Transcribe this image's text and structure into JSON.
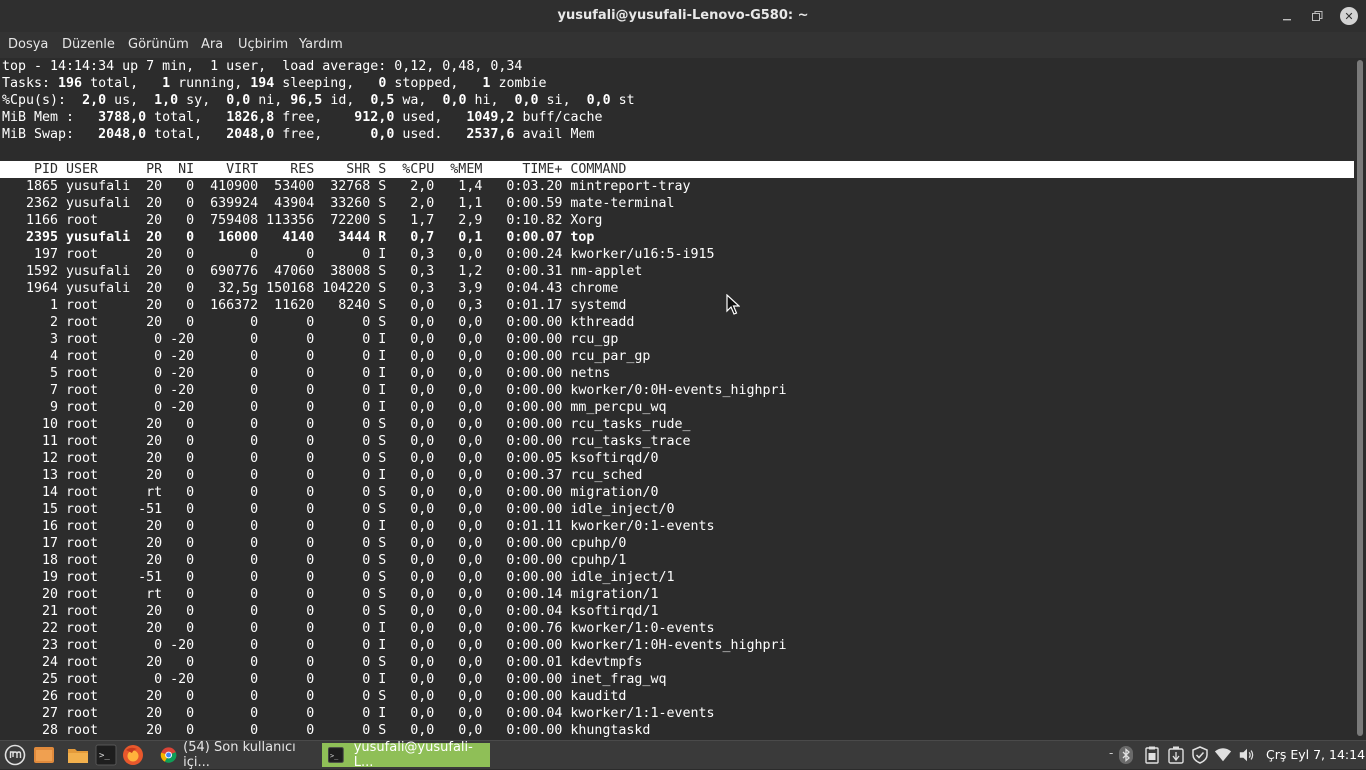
{
  "window": {
    "title": "yusufali@yusufali-Lenovo-G580: ~"
  },
  "menu": [
    "Dosya",
    "Düzenle",
    "Görünüm",
    "Ara",
    "Uçbirim",
    "Yardım"
  ],
  "top_summary": {
    "line1": "top - 14:14:34 up 7 min,  1 user,  load average: 0,12, 0,48, 0,34",
    "tasks": {
      "p1": "Tasks: ",
      "total": "196",
      "p2": " total,   ",
      "running": "1",
      "p3": " running, ",
      "sleeping": "194",
      "p4": " sleeping,   ",
      "stopped": "0",
      "p5": " stopped,   ",
      "zombie": "1",
      "p6": " zombie"
    },
    "cpu": {
      "p1": "%Cpu(s):  ",
      "us": "2,0",
      "p2": " us,  ",
      "sy": "1,0",
      "p3": " sy,  ",
      "ni": "0,0",
      "p4": " ni, ",
      "id": "96,5",
      "p5": " id,  ",
      "wa": "0,5",
      "p6": " wa,  ",
      "hi": "0,0",
      "p7": " hi,  ",
      "si": "0,0",
      "p8": " si,  ",
      "st": "0,0",
      "p9": " st"
    },
    "mem": {
      "p1": "MiB Mem :   ",
      "total": "3788,0",
      "p2": " total,   ",
      "free": "1826,8",
      "p3": " free,    ",
      "used": "912,0",
      "p4": " used,   ",
      "buff": "1049,2",
      "p5": " buff/cache"
    },
    "swap": {
      "p1": "MiB Swap:   ",
      "total": "2048,0",
      "p2": " total,   ",
      "free": "2048,0",
      "p3": " free,      ",
      "used": "0,0",
      "p4": " used.   ",
      "avail": "2537,6",
      "p5": " avail Mem"
    }
  },
  "columns": [
    "PID",
    "USER",
    "PR",
    "NI",
    "VIRT",
    "RES",
    "SHR",
    "S",
    "%CPU",
    "%MEM",
    "TIME+",
    "COMMAND"
  ],
  "processes": [
    [
      "1865",
      "yusufali",
      "20",
      "0",
      "410900",
      "53400",
      "32768",
      "S",
      "2,0",
      "1,4",
      "0:03.20",
      "mintreport-tray"
    ],
    [
      "2362",
      "yusufali",
      "20",
      "0",
      "639924",
      "43904",
      "33260",
      "S",
      "2,0",
      "1,1",
      "0:00.59",
      "mate-terminal"
    ],
    [
      "1166",
      "root",
      "20",
      "0",
      "759408",
      "113356",
      "72200",
      "S",
      "1,7",
      "2,9",
      "0:10.82",
      "Xorg"
    ],
    [
      "2395",
      "yusufali",
      "20",
      "0",
      "16000",
      "4140",
      "3444",
      "R",
      "0,7",
      "0,1",
      "0:00.07",
      "top"
    ],
    [
      "197",
      "root",
      "20",
      "0",
      "0",
      "0",
      "0",
      "I",
      "0,3",
      "0,0",
      "0:00.24",
      "kworker/u16:5-i915"
    ],
    [
      "1592",
      "yusufali",
      "20",
      "0",
      "690776",
      "47060",
      "38008",
      "S",
      "0,3",
      "1,2",
      "0:00.31",
      "nm-applet"
    ],
    [
      "1964",
      "yusufali",
      "20",
      "0",
      "32,5g",
      "150168",
      "104220",
      "S",
      "0,3",
      "3,9",
      "0:04.43",
      "chrome"
    ],
    [
      "1",
      "root",
      "20",
      "0",
      "166372",
      "11620",
      "8240",
      "S",
      "0,0",
      "0,3",
      "0:01.17",
      "systemd"
    ],
    [
      "2",
      "root",
      "20",
      "0",
      "0",
      "0",
      "0",
      "S",
      "0,0",
      "0,0",
      "0:00.00",
      "kthreadd"
    ],
    [
      "3",
      "root",
      "0",
      "-20",
      "0",
      "0",
      "0",
      "I",
      "0,0",
      "0,0",
      "0:00.00",
      "rcu_gp"
    ],
    [
      "4",
      "root",
      "0",
      "-20",
      "0",
      "0",
      "0",
      "I",
      "0,0",
      "0,0",
      "0:00.00",
      "rcu_par_gp"
    ],
    [
      "5",
      "root",
      "0",
      "-20",
      "0",
      "0",
      "0",
      "I",
      "0,0",
      "0,0",
      "0:00.00",
      "netns"
    ],
    [
      "7",
      "root",
      "0",
      "-20",
      "0",
      "0",
      "0",
      "I",
      "0,0",
      "0,0",
      "0:00.00",
      "kworker/0:0H-events_highpri"
    ],
    [
      "9",
      "root",
      "0",
      "-20",
      "0",
      "0",
      "0",
      "I",
      "0,0",
      "0,0",
      "0:00.00",
      "mm_percpu_wq"
    ],
    [
      "10",
      "root",
      "20",
      "0",
      "0",
      "0",
      "0",
      "S",
      "0,0",
      "0,0",
      "0:00.00",
      "rcu_tasks_rude_"
    ],
    [
      "11",
      "root",
      "20",
      "0",
      "0",
      "0",
      "0",
      "S",
      "0,0",
      "0,0",
      "0:00.00",
      "rcu_tasks_trace"
    ],
    [
      "12",
      "root",
      "20",
      "0",
      "0",
      "0",
      "0",
      "S",
      "0,0",
      "0,0",
      "0:00.05",
      "ksoftirqd/0"
    ],
    [
      "13",
      "root",
      "20",
      "0",
      "0",
      "0",
      "0",
      "I",
      "0,0",
      "0,0",
      "0:00.37",
      "rcu_sched"
    ],
    [
      "14",
      "root",
      "rt",
      "0",
      "0",
      "0",
      "0",
      "S",
      "0,0",
      "0,0",
      "0:00.00",
      "migration/0"
    ],
    [
      "15",
      "root",
      "-51",
      "0",
      "0",
      "0",
      "0",
      "S",
      "0,0",
      "0,0",
      "0:00.00",
      "idle_inject/0"
    ],
    [
      "16",
      "root",
      "20",
      "0",
      "0",
      "0",
      "0",
      "I",
      "0,0",
      "0,0",
      "0:01.11",
      "kworker/0:1-events"
    ],
    [
      "17",
      "root",
      "20",
      "0",
      "0",
      "0",
      "0",
      "S",
      "0,0",
      "0,0",
      "0:00.00",
      "cpuhp/0"
    ],
    [
      "18",
      "root",
      "20",
      "0",
      "0",
      "0",
      "0",
      "S",
      "0,0",
      "0,0",
      "0:00.00",
      "cpuhp/1"
    ],
    [
      "19",
      "root",
      "-51",
      "0",
      "0",
      "0",
      "0",
      "S",
      "0,0",
      "0,0",
      "0:00.00",
      "idle_inject/1"
    ],
    [
      "20",
      "root",
      "rt",
      "0",
      "0",
      "0",
      "0",
      "S",
      "0,0",
      "0,0",
      "0:00.14",
      "migration/1"
    ],
    [
      "21",
      "root",
      "20",
      "0",
      "0",
      "0",
      "0",
      "S",
      "0,0",
      "0,0",
      "0:00.04",
      "ksoftirqd/1"
    ],
    [
      "22",
      "root",
      "20",
      "0",
      "0",
      "0",
      "0",
      "I",
      "0,0",
      "0,0",
      "0:00.76",
      "kworker/1:0-events"
    ],
    [
      "23",
      "root",
      "0",
      "-20",
      "0",
      "0",
      "0",
      "I",
      "0,0",
      "0,0",
      "0:00.00",
      "kworker/1:0H-events_highpri"
    ],
    [
      "24",
      "root",
      "20",
      "0",
      "0",
      "0",
      "0",
      "S",
      "0,0",
      "0,0",
      "0:00.01",
      "kdevtmpfs"
    ],
    [
      "25",
      "root",
      "0",
      "-20",
      "0",
      "0",
      "0",
      "I",
      "0,0",
      "0,0",
      "0:00.00",
      "inet_frag_wq"
    ],
    [
      "26",
      "root",
      "20",
      "0",
      "0",
      "0",
      "0",
      "S",
      "0,0",
      "0,0",
      "0:00.00",
      "kauditd"
    ],
    [
      "27",
      "root",
      "20",
      "0",
      "0",
      "0",
      "0",
      "I",
      "0,0",
      "0,0",
      "0:00.04",
      "kworker/1:1-events"
    ],
    [
      "28",
      "root",
      "20",
      "0",
      "0",
      "0",
      "0",
      "S",
      "0,0",
      "0,0",
      "0:00.00",
      "khungtaskd"
    ]
  ],
  "highlighted_pid": "2395",
  "taskbar": {
    "launchers": [
      "menu-icon",
      "show-desktop-icon",
      "files-icon",
      "terminal-icon",
      "firefox-icon"
    ],
    "tasks": [
      {
        "label": "(54) Son kullanıcı içi...",
        "icon": "chrome-icon",
        "active": false
      },
      {
        "label": "yusufali@yusufali-L...",
        "icon": "terminal-icon",
        "active": true
      }
    ],
    "tray": [
      "bluetooth-icon",
      "clipboard-icon",
      "battery-icon",
      "shield-icon",
      "wifi-icon",
      "volume-icon"
    ],
    "tray_separator": "-",
    "clock": "Çrş Eyl  7, 14:14"
  },
  "colors": {
    "accent": "#8fbf57",
    "terminal_bg": "#2c2c2c",
    "terminal_fg": "#ffffff"
  }
}
